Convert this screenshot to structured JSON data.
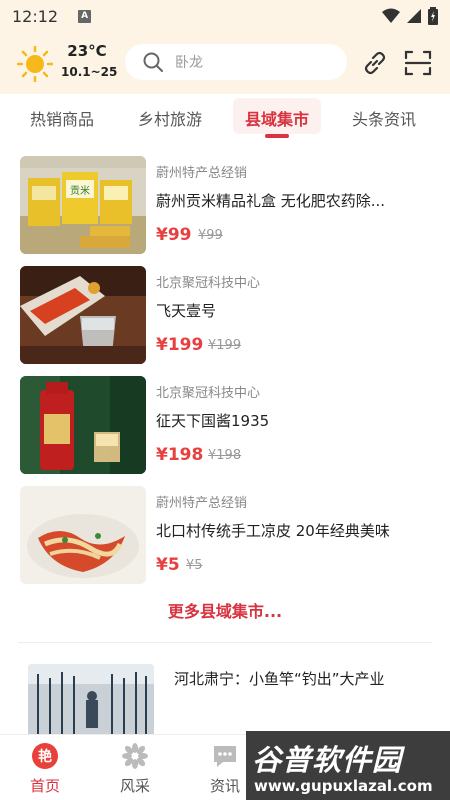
{
  "status_bar": {
    "time": "12:12",
    "badge": "A"
  },
  "header": {
    "weather_icon": "sun-icon",
    "temperature": "23°C",
    "temp_range": "10.1~25",
    "search_placeholder": "卧龙",
    "link_icon": "link-icon",
    "scan_icon": "scan-icon",
    "accent_color": "#d93340",
    "background_color": "#fdf4e6"
  },
  "tabs": [
    {
      "label": "热销商品",
      "active": false
    },
    {
      "label": "乡村旅游",
      "active": false
    },
    {
      "label": "县域集市",
      "active": true
    },
    {
      "label": "头条资讯",
      "active": false
    }
  ],
  "products": [
    {
      "shop": "蔚州特产总经销",
      "name": "蔚州贡米精品礼盒 无化肥农药除...",
      "price": "¥99",
      "original_price": "¥99"
    },
    {
      "shop": "北京聚冠科技中心",
      "name": "飞天壹号",
      "price": "¥199",
      "original_price": "¥199"
    },
    {
      "shop": "北京聚冠科技中心",
      "name": "征天下国酱1935",
      "price": "¥198",
      "original_price": "¥198"
    },
    {
      "shop": "蔚州特产总经销",
      "name": "北口村传统手工凉皮 20年经典美味",
      "price": "¥5",
      "original_price": "¥5"
    }
  ],
  "more_link": "更多县域集市...",
  "news": [
    {
      "title": "河北肃宁：小鱼竿“钓出”大产业"
    }
  ],
  "bottom_nav": [
    {
      "label": "首页",
      "icon": "home-icon",
      "active": true
    },
    {
      "label": "风采",
      "icon": "flower-icon",
      "active": false
    },
    {
      "label": "资讯",
      "icon": "chat-icon",
      "active": false
    }
  ],
  "watermark": {
    "text": "谷普软件园",
    "url": "www.gupuxlazal.com"
  }
}
